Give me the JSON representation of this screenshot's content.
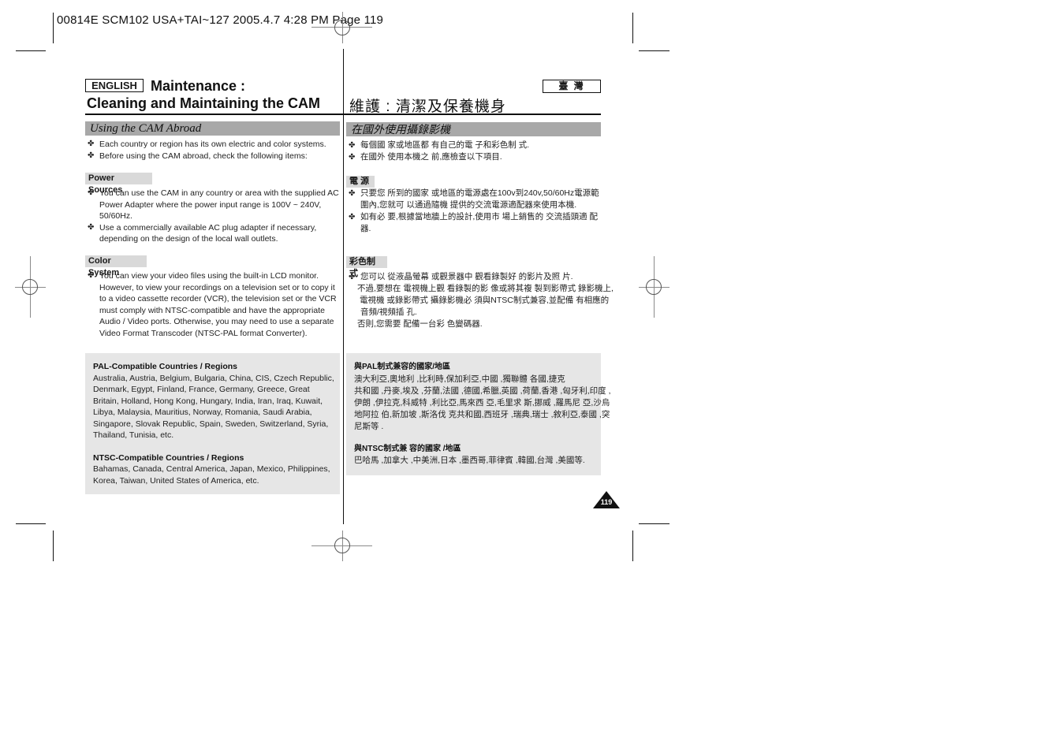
{
  "print_slug": "00814E SCM102 USA+TAI~127 2005.4.7 4:28 PM Page 119",
  "header": {
    "language_label": "ENGLISH",
    "title_line1": "Maintenance :",
    "title_line2": "Cleaning and Maintaining the CAM",
    "zh_language_label": "臺 灣",
    "zh_title": "維護 : 清潔及保養機身"
  },
  "english": {
    "section_title": "Using the CAM Abroad",
    "intro_bullets": [
      "Each country or region has its own electric and color systems.",
      "Before using the CAM abroad, check the following items:"
    ],
    "power": {
      "heading": "Power Sources",
      "bullets": [
        "You can use the CAM in any country or area with the supplied AC Power Adapter where the power input range is 100V ~ 240V, 50/60Hz.",
        "Use a commercially available AC plug adapter if necessary, depending on the design of the local wall outlets."
      ]
    },
    "color": {
      "heading": "Color System",
      "bullets": [
        "You can view your video files using the built-in LCD monitor. However, to view your recordings on a television set or to copy it to a video cassette recorder (VCR), the television set or the VCR must comply with NTSC-compatible and have the appropriate Audio / Video ports. Otherwise, you may need to use a separate Video Format Transcoder (NTSC-PAL format Converter)."
      ]
    },
    "pal": {
      "heading": "PAL-Compatible Countries / Regions",
      "text": "Australia, Austria, Belgium, Bulgaria, China, CIS, Czech Republic, Denmark, Egypt, Finland, France, Germany, Greece, Great Britain, Holland, Hong Kong, Hungary, India, Iran, Iraq, Kuwait, Libya, Malaysia, Mauritius, Norway, Romania, Saudi Arabia, Singapore, Slovak Republic, Spain, Sweden, Switzerland, Syria, Thailand, Tunisia, etc."
    },
    "ntsc": {
      "heading": "NTSC-Compatible Countries / Regions",
      "text": "Bahamas, Canada, Central America, Japan, Mexico, Philippines, Korea, Taiwan, United States of America, etc."
    }
  },
  "chinese": {
    "section_title": "在國外使用攝錄影機",
    "intro_bullets": [
      "每個國 家或地區都 有自己的電 子和彩色制 式.",
      "在國外 使用本機之 前,應檢查以下項目."
    ],
    "power": {
      "heading": "電 源",
      "bullets": [
        "只要您 所到的國家 或地區的電源處在100v到240v,50/60Hz電源範圍內,您就可 以通過隨機 提供的交流電源適配器來使用本機.",
        "如有必 要,根據當地牆上的設計,使用市 場上銷售的 交流插頭適 配器."
      ]
    },
    "color": {
      "heading": "彩色制 式",
      "bullet": "您可以 從液晶螢幕 或觀景器中 觀看錄製好 的影片及照 片.",
      "lines": [
        "不過,要想在 電視機上觀 看錄製的影 像或將其複 製到影帶式 錄影機上,",
        "電視機 或錄影帶式 攝錄影機必 須與NTSC制式兼容,並配備 有相應的",
        "音頻/視頻插 孔.",
        "否則,您需要 配備一台彩 色變碼器."
      ]
    },
    "pal": {
      "heading": "與PAL制式兼容的國家/地區",
      "lines": [
        "澳大利亞,奧地利 ,比利時,保加利亞,中國 ,獨聯體 各國,捷克",
        "共和國 ,丹麥,埃及 ,芬蘭,法國 ,德國,希臘,英國 ,荷蘭,香港 ,匈牙利,印度 ,",
        "伊朗 ,伊拉克,科威特 ,利比亞,馬來西 亞,毛里求 斯,挪威 ,羅馬尼 亞,沙烏",
        "地阿拉 伯,新加坡 ,斯洛伐 克共和國,西班牙 ,瑞典,瑞士 ,敘利亞,泰國 ,突",
        "尼斯等 ."
      ]
    },
    "ntsc": {
      "heading": "與NTSC制式兼 容的國家 /地區",
      "text": "巴哈馬 ,加拿大 ,中美洲,日本 ,墨西哥,菲律賓 ,韓國,台灣 ,美國等."
    }
  },
  "page_number": "119",
  "icons": {
    "bullet": "✤"
  }
}
